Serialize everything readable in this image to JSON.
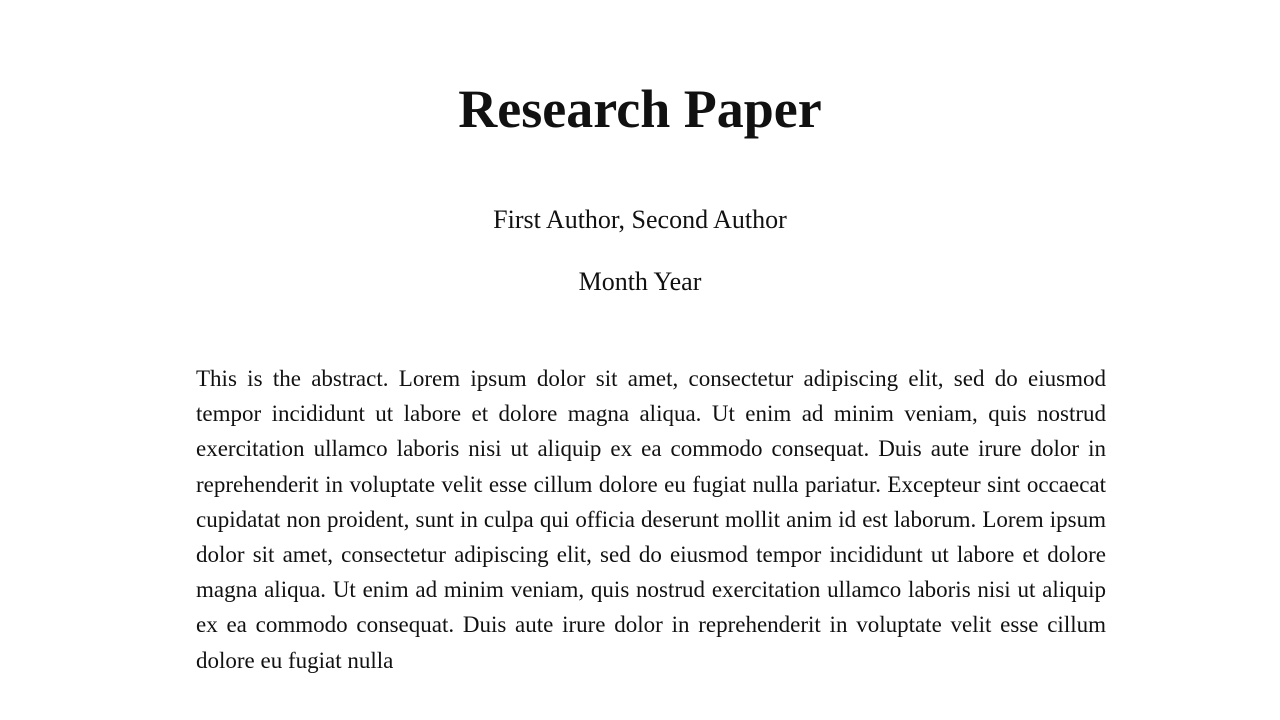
{
  "paper": {
    "title": "Research Paper",
    "authors": "First Author, Second Author",
    "date": "Month Year",
    "abstract": "This is the abstract. Lorem ipsum dolor sit amet, consectetur adipiscing elit, sed do eiusmod tempor incididunt ut labore et dolore magna aliqua. Ut enim ad minim veniam, quis nostrud exercitation ullamco laboris nisi ut aliquip ex ea commodo consequat. Duis aute irure dolor in reprehenderit in voluptate velit esse cillum dolore eu fugiat nulla pariatur. Excepteur sint occaecat cupidatat non proident, sunt in culpa qui officia deserunt mollit anim id est laborum. Lorem ipsum dolor sit amet, consectetur adipiscing elit, sed do eiusmod tempor incididunt ut labore et dolore magna aliqua. Ut enim ad minim veniam, quis nostrud exercitation ullamco laboris nisi ut aliquip ex ea commodo consequat. Duis aute irure dolor in reprehenderit in voluptate velit esse cillum dolore eu fugiat nulla"
  },
  "colors": {
    "background": "#ffffff",
    "text": "#111111"
  }
}
